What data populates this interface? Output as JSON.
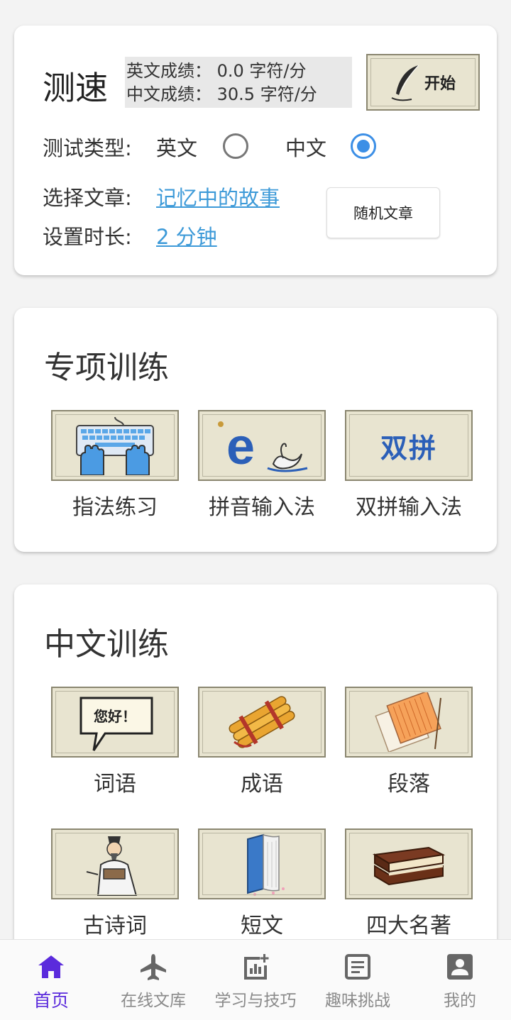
{
  "speed_test": {
    "title": "测速",
    "english_score": "英文成绩： 0.0 字符/分",
    "chinese_score": "中文成绩： 30.5 字符/分",
    "start_label": "开始",
    "test_type_label": "测试类型:",
    "option_english": "英文",
    "option_chinese": "中文",
    "selected_type": "中文",
    "choose_article_label": "选择文章:",
    "article_name": "记忆中的故事",
    "duration_label": "设置时长:",
    "duration_value": "2 分钟",
    "random_button": "随机文章"
  },
  "special_training": {
    "title": "专项训练",
    "items": [
      {
        "label": "指法练习",
        "icon": "keyboard-hands-icon"
      },
      {
        "label": "拼音输入法",
        "icon": "pinyin-e-swan-icon"
      },
      {
        "label": "双拼输入法",
        "icon_text": "双拼",
        "icon": "shuangpin-icon"
      }
    ]
  },
  "chinese_training": {
    "title": "中文训练",
    "items": [
      {
        "label": "词语",
        "icon_text": "您好！",
        "icon": "speech-bubble-icon"
      },
      {
        "label": "成语",
        "icon": "bamboo-scroll-icon"
      },
      {
        "label": "段落",
        "icon": "paper-pages-icon"
      },
      {
        "label": "古诗词",
        "icon": "scholar-icon"
      },
      {
        "label": "短文",
        "icon": "open-book-icon"
      },
      {
        "label": "四大名著",
        "icon": "book-stack-icon"
      }
    ]
  },
  "bottom_nav": [
    {
      "label": "首页",
      "icon": "home-icon",
      "active": true
    },
    {
      "label": "在线文库",
      "icon": "airplane-icon",
      "active": false
    },
    {
      "label": "学习与技巧",
      "icon": "chart-plus-icon",
      "active": false
    },
    {
      "label": "趣味挑战",
      "icon": "document-icon",
      "active": false
    },
    {
      "label": "我的",
      "icon": "profile-icon",
      "active": false
    }
  ],
  "colors": {
    "accent_blue": "#3c8fe6",
    "link_blue": "#3d9ad8",
    "nav_active": "#5b2bdc",
    "tile_bg": "#e8e4d0"
  }
}
